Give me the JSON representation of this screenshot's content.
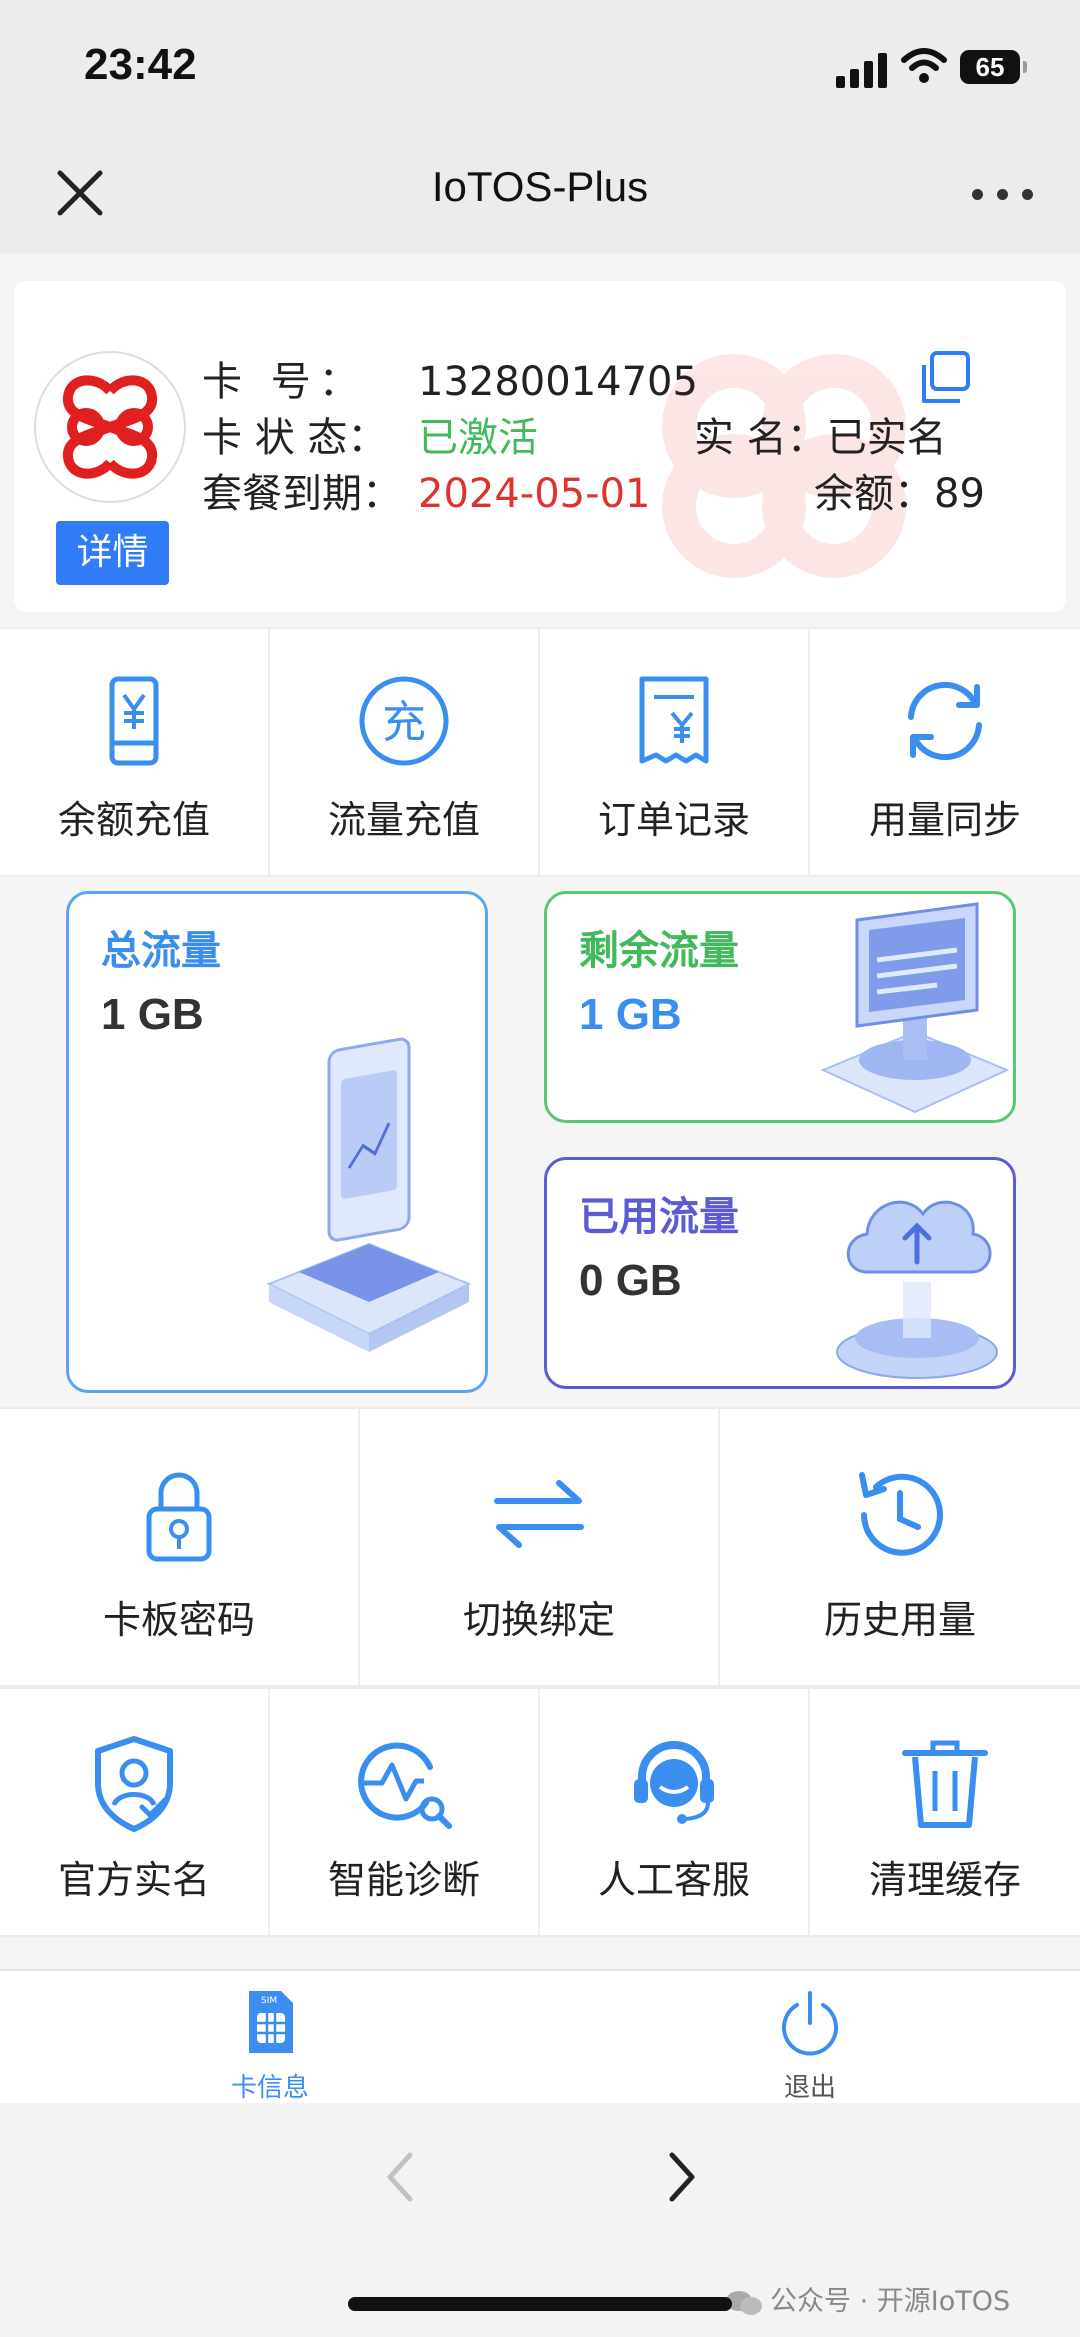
{
  "status_bar": {
    "time": "23:42",
    "battery": "65"
  },
  "nav": {
    "title": "IoTOS-Plus"
  },
  "card": {
    "card_no_label": "卡 号：",
    "card_no": "13280014705",
    "status_label": "卡 状 态：",
    "status": "已激活",
    "realname_label": "实 名：",
    "realname": "已实名",
    "expire_label": "套餐到期：",
    "expire": "2024-05-01",
    "balance_label": "余额：",
    "balance": "89",
    "detail_button": "详情"
  },
  "actions_top": [
    {
      "label": "余额充值",
      "icon": "phone-yen-icon"
    },
    {
      "label": "流量充值",
      "icon": "recharge-circle-icon"
    },
    {
      "label": "订单记录",
      "icon": "receipt-icon"
    },
    {
      "label": "用量同步",
      "icon": "sync-icon"
    }
  ],
  "flow": {
    "total": {
      "title": "总流量",
      "value": "1 GB"
    },
    "remaining": {
      "title": "剩余流量",
      "value": "1 GB"
    },
    "used": {
      "title": "已用流量",
      "value": "0 GB"
    }
  },
  "actions_mid": [
    {
      "label": "卡板密码",
      "icon": "lock-icon"
    },
    {
      "label": "切换绑定",
      "icon": "swap-icon"
    },
    {
      "label": "历史用量",
      "icon": "history-icon"
    }
  ],
  "actions_bottom": [
    {
      "label": "官方实名",
      "icon": "shield-user-icon"
    },
    {
      "label": "智能诊断",
      "icon": "diagnose-icon"
    },
    {
      "label": "人工客服",
      "icon": "headset-icon"
    },
    {
      "label": "清理缓存",
      "icon": "trash-icon"
    }
  ],
  "tabbar": {
    "card_info": "卡信息",
    "sim_text": "SIM",
    "logout": "退出"
  },
  "watermark": {
    "text": "公众号 · 开源IoTOS"
  },
  "colors": {
    "accent": "#2f7cf6",
    "green": "#42b95d",
    "red": "#e03131",
    "purple": "#5b5bd6"
  }
}
